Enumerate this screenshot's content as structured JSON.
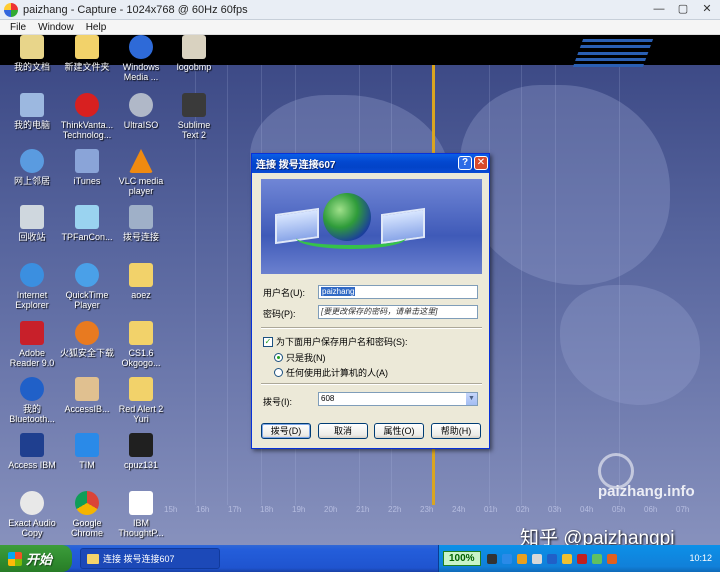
{
  "capture_window": {
    "title": "paizhang - Capture - 1024x768 @ 60Hz 60fps",
    "menu": [
      "File",
      "Window",
      "Help"
    ],
    "controls": {
      "minimize": "—",
      "maximize": "▢",
      "close": "✕"
    }
  },
  "desktop": {
    "icons": [
      {
        "label": "我的文档",
        "icon": "documents-icon",
        "color": "#e8d58a"
      },
      {
        "label": "新建文件夹",
        "icon": "folder-icon",
        "color": "#f2d26a"
      },
      {
        "label": "Windows\nMedia ...",
        "icon": "media-player-icon",
        "color": "#2e6ad8"
      },
      {
        "label": "logobmp",
        "icon": "paint-icon",
        "color": "#d9d2c0"
      },
      {
        "label": "我的电脑",
        "icon": "computer-icon",
        "color": "#9cb8e0"
      },
      {
        "label": "ThinkVanta...\nTechnolog...",
        "icon": "thinkvantage-icon",
        "color": "#d82020"
      },
      {
        "label": "UltraISO",
        "icon": "disc-icon",
        "color": "#b0b8c8"
      },
      {
        "label": "Sublime\nText 2",
        "icon": "sublime-icon",
        "color": "#3a3a3a"
      },
      {
        "label": "网上邻居",
        "icon": "network-icon",
        "color": "#5a9be0"
      },
      {
        "label": "iTunes",
        "icon": "itunes-icon",
        "color": "#8aa4d8"
      },
      {
        "label": "VLC media\nplayer",
        "icon": "vlc-icon",
        "color": "#f08a10"
      },
      {
        "label": "回收站",
        "icon": "recycle-bin-icon",
        "color": "#cfd7de"
      },
      {
        "label": "TPFanCon...",
        "icon": "tpfancontrol-icon",
        "color": "#9ad3f0"
      },
      {
        "label": "拨号连接",
        "icon": "dialup-icon",
        "color": "#9fb0c8"
      },
      {
        "label": "Internet\nExplorer",
        "icon": "ie-icon",
        "color": "#3b8fe0"
      },
      {
        "label": "QuickTime\nPlayer",
        "icon": "quicktime-icon",
        "color": "#4aa0e8"
      },
      {
        "label": "aoez",
        "icon": "folder-icon",
        "color": "#f2d26a"
      },
      {
        "label": "Adobe\nReader 9.0",
        "icon": "adobe-reader-icon",
        "color": "#c8202a"
      },
      {
        "label": "火狐安全下载",
        "icon": "firefox-icon",
        "color": "#e87a20"
      },
      {
        "label": "CS1.6\nOkgogo...",
        "icon": "folder-icon",
        "color": "#f2d26a"
      },
      {
        "label": "我的\nBluetooth...",
        "icon": "bluetooth-icon",
        "color": "#2060c8"
      },
      {
        "label": "AccessIB...",
        "icon": "access-ibm-icon",
        "color": "#e0c090"
      },
      {
        "label": "Red Alert 2\nYuri",
        "icon": "folder-icon",
        "color": "#f2d26a"
      },
      {
        "label": "Access IBM",
        "icon": "ibm-icon",
        "color": "#1f3f8f"
      },
      {
        "label": "TIM",
        "icon": "tim-icon",
        "color": "#2a8ae8"
      },
      {
        "label": "cpuz131",
        "icon": "cpu-icon",
        "color": "#202020"
      },
      {
        "label": "Exact Audio\nCopy",
        "icon": "eac-icon",
        "color": "#e8e8e8"
      },
      {
        "label": "Google\nChrome",
        "icon": "chrome-icon",
        "color": "#e0e0e0"
      },
      {
        "label": "IBM\nThoughtP...",
        "icon": "ibm-doc-icon",
        "color": "#ffffff"
      }
    ],
    "time_ticks": [
      "15h",
      "16h",
      "17h",
      "18h",
      "19h",
      "20h",
      "21h",
      "22h",
      "23h",
      "24h",
      "01h",
      "02h",
      "03h",
      "04h",
      "05h",
      "06h",
      "07h"
    ],
    "watermark": "paizhang.info",
    "zhihu_credit": "知乎 @paizhangpi"
  },
  "dialog": {
    "title": "连接 拨号连接607",
    "help_button": "?",
    "close_button": "✕",
    "username_label": "用户名(U):",
    "username_value": "paizhang",
    "password_label": "密码(P):",
    "password_value": "[要更改保存的密码，请单击这里]",
    "save_checkbox_label": "为下面用户保存用户名和密码(S):",
    "save_checked": true,
    "radio_me_label": "只是我(N)",
    "radio_me_checked": true,
    "radio_anyone_label": "任何使用此计算机的人(A)",
    "radio_anyone_checked": false,
    "dial_label": "拨号(I):",
    "dial_value": "608",
    "buttons": {
      "dial": "拨号(D)",
      "cancel": "取消",
      "properties": "属性(O)",
      "help": "帮助(H)"
    }
  },
  "taskbar": {
    "start_label": "开始",
    "task_item": "连接 拨号连接607",
    "zoom": "100%",
    "clock": "10:12"
  }
}
